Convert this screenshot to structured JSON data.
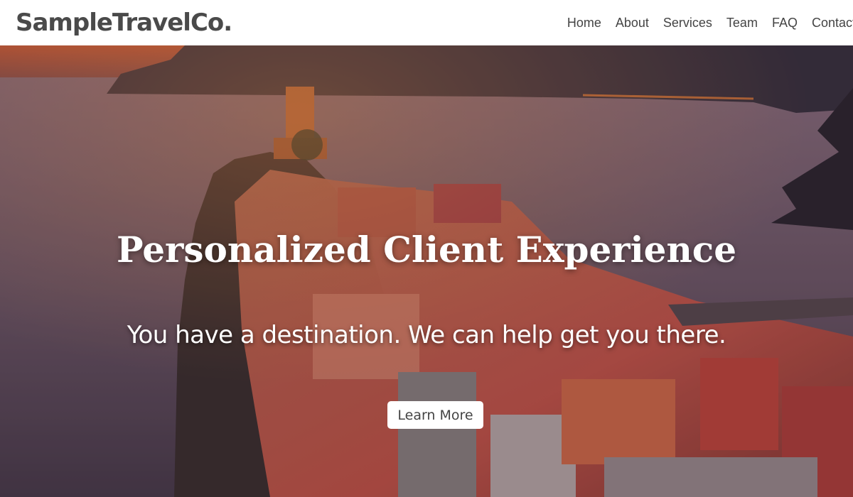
{
  "brand": {
    "name": "SampleTravelCo."
  },
  "nav": {
    "items": [
      {
        "label": "Home"
      },
      {
        "label": "About"
      },
      {
        "label": "Services"
      },
      {
        "label": "Team"
      },
      {
        "label": "FAQ"
      },
      {
        "label": "Contact"
      }
    ]
  },
  "hero": {
    "title": "Personalized Client Experience",
    "subtitle": "You have a destination. We can help get you there.",
    "button_label": "Learn More",
    "background_image": "coastal-cliff-village-at-dusk"
  },
  "colors": {
    "navbar_bg": "#ffffff",
    "brand_text": "#4a4a4a",
    "nav_text": "#444444",
    "hero_text": "#ffffff",
    "button_bg": "#ffffff",
    "button_text": "#444444"
  }
}
